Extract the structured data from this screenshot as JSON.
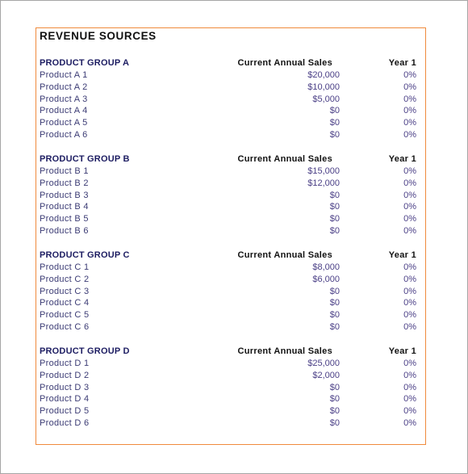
{
  "title": "REVENUE SOURCES",
  "columns": {
    "sales": "Current Annual Sales",
    "year": "Year 1"
  },
  "colors": {
    "box_border": "#f08a3c",
    "group_header": "#1d1d62",
    "product_text": "#3b3b74",
    "value_text": "#4a3f86"
  },
  "groups": [
    {
      "name": "PRODUCT GROUP A",
      "products": [
        {
          "name": "Product A 1",
          "sales": "$20,000",
          "year1": "0%"
        },
        {
          "name": "Product A 2",
          "sales": "$10,000",
          "year1": "0%"
        },
        {
          "name": "Product A 3",
          "sales": "$5,000",
          "year1": "0%"
        },
        {
          "name": "Product A 4",
          "sales": "$0",
          "year1": "0%"
        },
        {
          "name": "Product A 5",
          "sales": "$0",
          "year1": "0%"
        },
        {
          "name": "Product A 6",
          "sales": "$0",
          "year1": "0%"
        }
      ]
    },
    {
      "name": "PRODUCT GROUP B",
      "products": [
        {
          "name": "Product B 1",
          "sales": "$15,000",
          "year1": "0%"
        },
        {
          "name": "Product B 2",
          "sales": "$12,000",
          "year1": "0%"
        },
        {
          "name": "Product B 3",
          "sales": "$0",
          "year1": "0%"
        },
        {
          "name": "Product B 4",
          "sales": "$0",
          "year1": "0%"
        },
        {
          "name": "Product B 5",
          "sales": "$0",
          "year1": "0%"
        },
        {
          "name": "Product B 6",
          "sales": "$0",
          "year1": "0%"
        }
      ]
    },
    {
      "name": "PRODUCT GROUP C",
      "products": [
        {
          "name": "Product C 1",
          "sales": "$8,000",
          "year1": "0%"
        },
        {
          "name": "Product C 2",
          "sales": "$6,000",
          "year1": "0%"
        },
        {
          "name": "Product C 3",
          "sales": "$0",
          "year1": "0%"
        },
        {
          "name": "Product C 4",
          "sales": "$0",
          "year1": "0%"
        },
        {
          "name": "Product C 5",
          "sales": "$0",
          "year1": "0%"
        },
        {
          "name": "Product C 6",
          "sales": "$0",
          "year1": "0%"
        }
      ]
    },
    {
      "name": "PRODUCT GROUP D",
      "products": [
        {
          "name": "Product D 1",
          "sales": "$25,000",
          "year1": "0%"
        },
        {
          "name": "Product D 2",
          "sales": "$2,000",
          "year1": "0%"
        },
        {
          "name": "Product D 3",
          "sales": "$0",
          "year1": "0%"
        },
        {
          "name": "Product D 4",
          "sales": "$0",
          "year1": "0%"
        },
        {
          "name": "Product D 5",
          "sales": "$0",
          "year1": "0%"
        },
        {
          "name": "Product D 6",
          "sales": "$0",
          "year1": "0%"
        }
      ]
    }
  ]
}
